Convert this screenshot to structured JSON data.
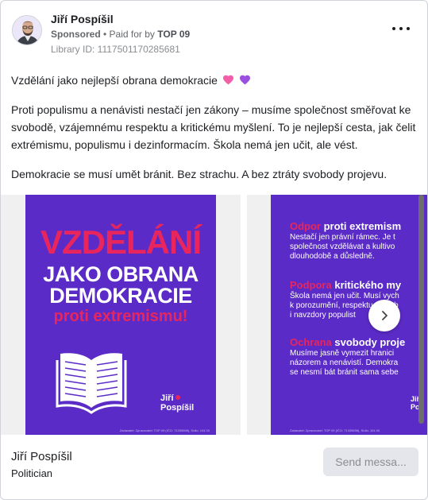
{
  "post": {
    "author": "Jiří Pospíšil",
    "sponsored": "Sponsored",
    "paid_for_prefix": " • Paid for by ",
    "paid_for_by": "TOP 09",
    "library_id": "Library ID: 1117501170285681",
    "more_icon": "more-horizontal-icon",
    "text_line1": "Vzdělání jako nejlepší obrana demokracie",
    "text_para2": "Proti populismu a nenávisti nestačí jen zákony – musíme společnost směřovat ke svobodě, vzájemnému respektu a kritickému myšlení. To je nejlepší cesta, jak čelit extrémismu, populismu i dezinformacím. Škola nemá jen učit, ale vést.",
    "text_para3": "Demokracie se musí umět bránit. Bez strachu. A bez ztráty svobody projevu.",
    "emoji": [
      "pink-heart-icon",
      "purple-heart-icon"
    ]
  },
  "carousel": {
    "slide1": {
      "title": "VZDĚLÁNÍ",
      "line2": "JAKO OBRANA",
      "line3": "DEMOKRACIE",
      "line4": "proti extremismu!",
      "logo_line1": "Jiří",
      "logo_line2": "Pospíšil",
      "fine_print": "Zadavatel: Zpracovatel: TOP 09 (IČO: 71339698), Sídlo: 104 00"
    },
    "slide2": {
      "b1_red": "Odpor",
      "b1_white": " proti extremism",
      "b1_l1": "Nestačí jen právní rámec. Je t",
      "b1_l2": "společnost vzdělávat a kultivo",
      "b1_l3": "dlouhodobě a důsledně.",
      "b2_red": "Podpora",
      "b2_white": " kritického my",
      "b2_l1": "Škola nemá jen učit. Musí vych",
      "b2_l2": "k porozumění, respektu a svob",
      "b2_l3": "i navzdory populist",
      "b3_red": "Ochrana",
      "b3_white": " svobody proje",
      "b3_l1": "Musíme jasně vymezit hranici",
      "b3_l2": "názorem a nenávistí. Demokra",
      "b3_l3": "se nesmí bát bránit sama sebe",
      "logo_line1": "Jiří",
      "logo_line2": "Pos",
      "fine_print": "Zadavatel: Zpracovatel: TOP 09 (IČO: 71339698), Sídlo: 104 00"
    },
    "next_icon": "chevron-right-icon"
  },
  "footer": {
    "name": "Jiří Pospíšil",
    "role": "Politician",
    "send_button": "Send messa..."
  },
  "colors": {
    "poster_purple": "#5a2bc6",
    "accent_red": "#e8265d",
    "heart_pink": "#f25ea8",
    "heart_purple": "#9b4fe0"
  }
}
